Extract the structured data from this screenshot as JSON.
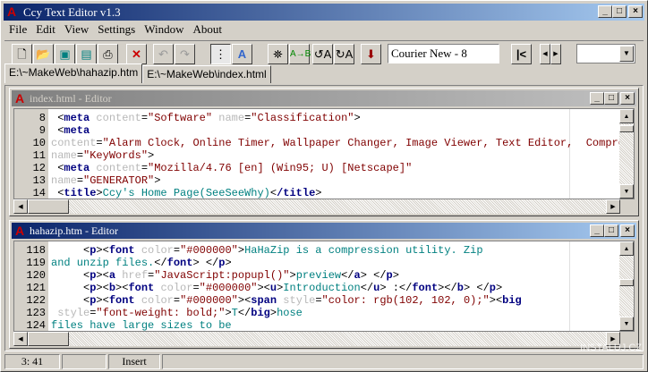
{
  "app": {
    "title": "Ccy Text Editor v1.3"
  },
  "menu": [
    "File",
    "Edit",
    "View",
    "Settings",
    "Window",
    "About"
  ],
  "toolbar": {
    "font_value": "Courier New - 8",
    "buttons": [
      "new-file",
      "open-file",
      "save",
      "save-all",
      "print",
      "close",
      "undo",
      "redo",
      "word-wrap",
      "font",
      "find",
      "replace",
      "find-previous",
      "find-next",
      "go-to-line",
      "go-first",
      "prev",
      "next",
      "dropdown"
    ]
  },
  "tabs": [
    "E:\\~MakeWeb\\hahazip.htm",
    "E:\\~MakeWeb\\index.html"
  ],
  "colors": {
    "tag": "#000080",
    "attr": "#b8b8b8",
    "value": "#800000",
    "text": "#008080",
    "active_title": "#0a246a"
  },
  "editors": [
    {
      "title": "index.html - Editor",
      "active": false,
      "lines": [
        {
          "n": "8",
          "tokens": [
            [
              "p",
              " <"
            ],
            [
              "t",
              "meta"
            ],
            [
              "a",
              " content"
            ],
            [
              "p",
              "="
            ],
            [
              "v",
              "\"Software\""
            ],
            [
              "a",
              " name"
            ],
            [
              "p",
              "="
            ],
            [
              "v",
              "\"Classification\""
            ],
            [
              "p",
              ">"
            ]
          ]
        },
        {
          "n": "9",
          "tokens": [
            [
              "p",
              " <"
            ],
            [
              "t",
              "meta"
            ]
          ]
        },
        {
          "n": "10",
          "tokens": [
            [
              "a",
              "content"
            ],
            [
              "p",
              "="
            ],
            [
              "v",
              "\"Alarm Clock, Online Timer, Wallpaper Changer, Image Viewer, Text Editor,  Compres"
            ]
          ]
        },
        {
          "n": "11",
          "tokens": [
            [
              "a",
              "name"
            ],
            [
              "p",
              "="
            ],
            [
              "v",
              "\"KeyWords\""
            ],
            [
              "p",
              ">"
            ]
          ]
        },
        {
          "n": "12",
          "tokens": [
            [
              "p",
              " <"
            ],
            [
              "t",
              "meta"
            ],
            [
              "a",
              " content"
            ],
            [
              "p",
              "="
            ],
            [
              "v",
              "\"Mozilla/4.76 [en] (Win95; U) [Netscape]\""
            ]
          ]
        },
        {
          "n": "13",
          "tokens": [
            [
              "a",
              "name"
            ],
            [
              "p",
              "="
            ],
            [
              "v",
              "\"GENERATOR\""
            ],
            [
              "p",
              ">"
            ]
          ]
        },
        {
          "n": "14",
          "tokens": [
            [
              "p",
              " <"
            ],
            [
              "t",
              "title"
            ],
            [
              "p",
              ">"
            ],
            [
              "x",
              "Ccy's Home Page(SeeSeeWhy)"
            ],
            [
              "p",
              "<"
            ],
            [
              "t",
              "/title"
            ],
            [
              "p",
              ">"
            ]
          ]
        }
      ]
    },
    {
      "title": "hahazip.htm - Editor",
      "active": true,
      "lines": [
        {
          "n": "118",
          "tokens": [
            [
              "p",
              "     <"
            ],
            [
              "t",
              "p"
            ],
            [
              "p",
              "><"
            ],
            [
              "t",
              "font"
            ],
            [
              "a",
              " color"
            ],
            [
              "p",
              "="
            ],
            [
              "v",
              "\"#000000\""
            ],
            [
              "p",
              ">"
            ],
            [
              "x",
              "HaHaZip is a compression utility. Zip"
            ]
          ]
        },
        {
          "n": "119",
          "tokens": [
            [
              "x",
              "and unzip files."
            ],
            [
              "p",
              "</"
            ],
            [
              "t",
              "font"
            ],
            [
              "p",
              "> </"
            ],
            [
              "t",
              "p"
            ],
            [
              "p",
              ">"
            ]
          ]
        },
        {
          "n": "120",
          "tokens": [
            [
              "p",
              "     <"
            ],
            [
              "t",
              "p"
            ],
            [
              "p",
              "><"
            ],
            [
              "t",
              "a"
            ],
            [
              "a",
              " href"
            ],
            [
              "p",
              "="
            ],
            [
              "v",
              "\"JavaScript:popupl()\""
            ],
            [
              "p",
              ">"
            ],
            [
              "x",
              "preview"
            ],
            [
              "p",
              "</"
            ],
            [
              "t",
              "a"
            ],
            [
              "p",
              "> </"
            ],
            [
              "t",
              "p"
            ],
            [
              "p",
              ">"
            ]
          ]
        },
        {
          "n": "121",
          "tokens": [
            [
              "p",
              "     <"
            ],
            [
              "t",
              "p"
            ],
            [
              "p",
              "><"
            ],
            [
              "t",
              "b"
            ],
            [
              "p",
              "><"
            ],
            [
              "t",
              "font"
            ],
            [
              "a",
              " color"
            ],
            [
              "p",
              "="
            ],
            [
              "v",
              "\"#000000\""
            ],
            [
              "p",
              "><"
            ],
            [
              "t",
              "u"
            ],
            [
              "p",
              ">"
            ],
            [
              "x",
              "Introduction"
            ],
            [
              "p",
              "</"
            ],
            [
              "t",
              "u"
            ],
            [
              "p",
              "> :</"
            ],
            [
              "t",
              "font"
            ],
            [
              "p",
              "></"
            ],
            [
              "t",
              "b"
            ],
            [
              "p",
              "> </"
            ],
            [
              "t",
              "p"
            ],
            [
              "p",
              ">"
            ]
          ]
        },
        {
          "n": "122",
          "tokens": [
            [
              "p",
              "     <"
            ],
            [
              "t",
              "p"
            ],
            [
              "p",
              "><"
            ],
            [
              "t",
              "font"
            ],
            [
              "a",
              " color"
            ],
            [
              "p",
              "="
            ],
            [
              "v",
              "\"#000000\""
            ],
            [
              "p",
              "><"
            ],
            [
              "t",
              "span"
            ],
            [
              "a",
              " style"
            ],
            [
              "p",
              "="
            ],
            [
              "v",
              "\"color: rgb(102, 102, 0);\""
            ],
            [
              "p",
              "><"
            ],
            [
              "t",
              "big"
            ]
          ]
        },
        {
          "n": "123",
          "tokens": [
            [
              "a",
              " style"
            ],
            [
              "p",
              "="
            ],
            [
              "v",
              "\"font-weight: bold;\""
            ],
            [
              "p",
              ">"
            ],
            [
              "x",
              "T"
            ],
            [
              "p",
              "</"
            ],
            [
              "t",
              "big"
            ],
            [
              "p",
              ">"
            ],
            [
              "x",
              "hose"
            ]
          ]
        },
        {
          "n": "124",
          "tokens": [
            [
              "x",
              "files have large sizes to be"
            ]
          ]
        }
      ]
    }
  ],
  "status": {
    "position": "3: 41",
    "mode": "Insert"
  },
  "watermark": "INSTALUJ.CZ"
}
